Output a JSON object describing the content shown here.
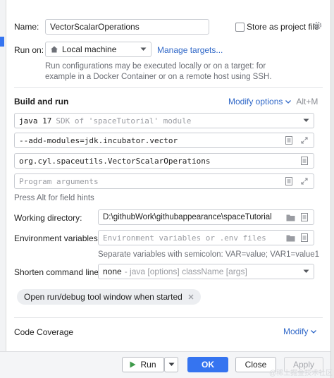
{
  "name": {
    "label": "Name:",
    "value": "VectorScalarOperations"
  },
  "store_as_project_file": {
    "label": "Store as project file",
    "checked": false
  },
  "run_on": {
    "label": "Run on:",
    "selected": "Local machine",
    "manage_targets_link": "Manage targets...",
    "hint_line1": "Run configurations may be executed locally or on a target: for",
    "hint_line2": "example in a Docker Container or on a remote host using SSH."
  },
  "build_and_run": {
    "title": "Build and run",
    "modify_options_label": "Modify options",
    "modify_options_shortcut": "Alt+M",
    "sdk_value": "java 17",
    "sdk_detail": "SDK of 'spaceTutorial' module",
    "vm_options_value": "--add-modules=jdk.incubator.vector",
    "main_class_value": "org.cyl.spaceutils.VectorScalarOperations",
    "program_args_placeholder": "Program arguments",
    "field_hint": "Press Alt for field hints"
  },
  "working_directory": {
    "label": "Working directory:",
    "value": "D:\\githubWork\\githubappearance\\spaceTutorial"
  },
  "environment_variables": {
    "label": "Environment variables:",
    "placeholder": "Environment variables or .env files",
    "hint": "Separate variables with semicolon: VAR=value; VAR1=value1"
  },
  "shorten_command_line": {
    "label": "Shorten command line:",
    "value": "none",
    "detail": "- java [options] className [args]"
  },
  "open_tool_window_chip": "Open run/debug tool window when started",
  "code_coverage": {
    "title": "Code Coverage",
    "modify_label": "Modify"
  },
  "buttons": {
    "run": "Run",
    "ok": "OK",
    "close": "Close",
    "apply": "Apply"
  },
  "watermark": "@稀土掘金技术社区",
  "colors": {
    "accent": "#3574f0",
    "link": "#3068c8",
    "run_green": "#3e9a4a"
  }
}
